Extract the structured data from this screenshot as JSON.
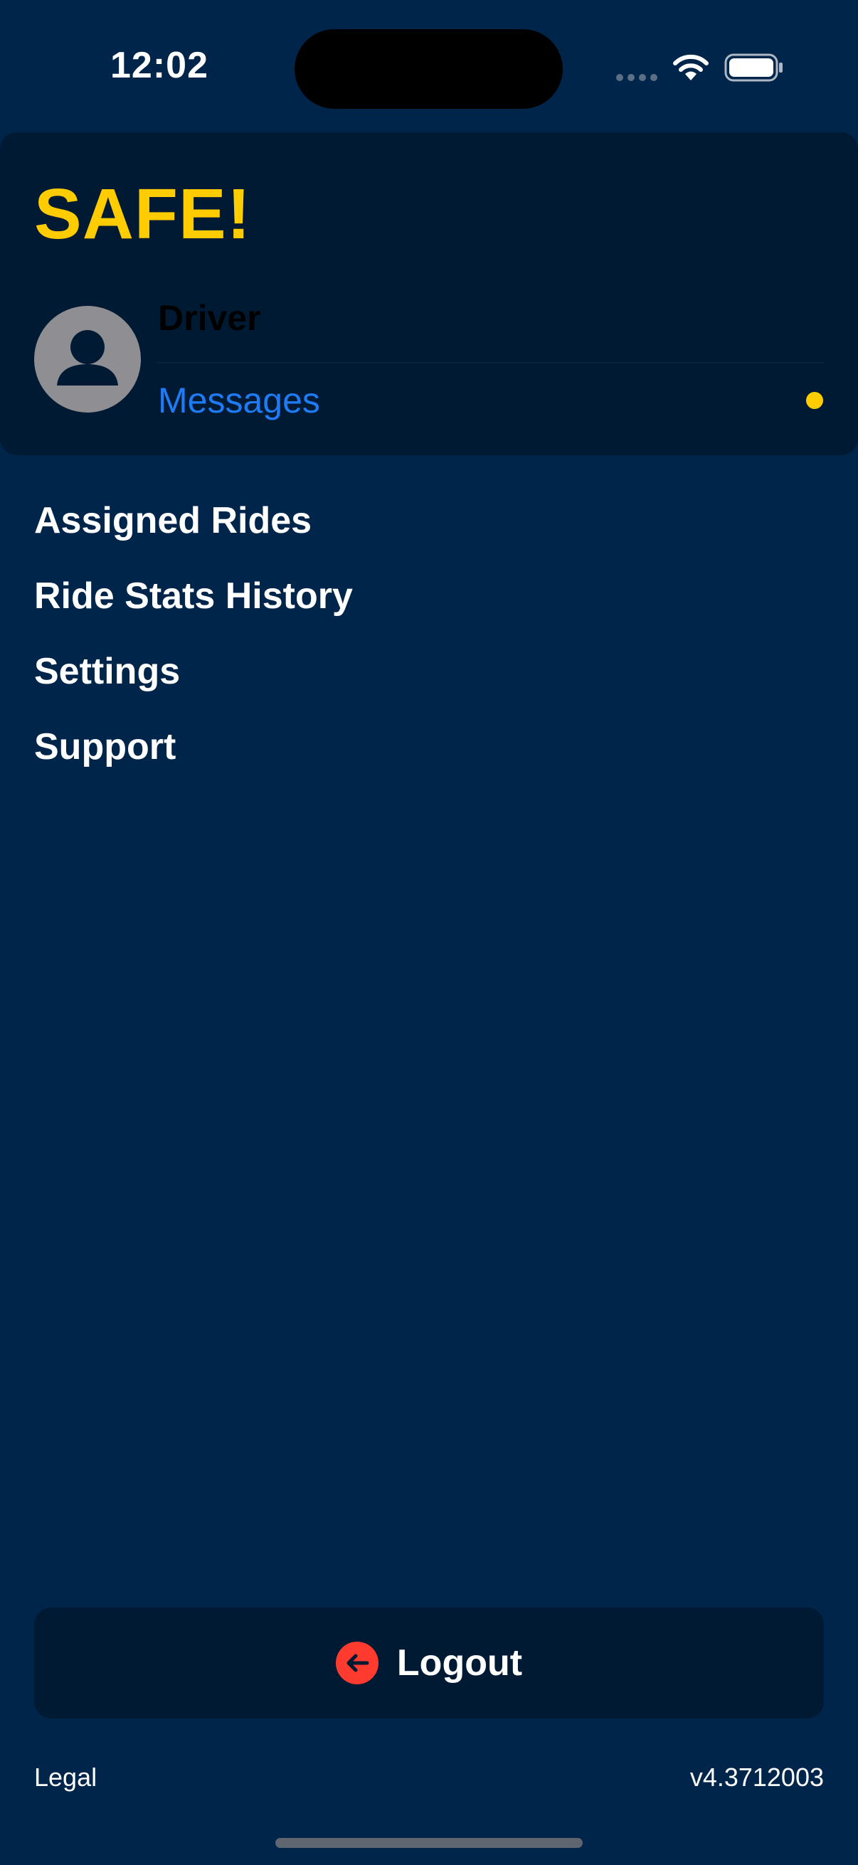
{
  "status_bar": {
    "time": "12:02"
  },
  "header": {
    "brand": "SAFE!",
    "user_name": "Driver",
    "messages_label": "Messages"
  },
  "menu": {
    "items": [
      {
        "label": "Assigned Rides"
      },
      {
        "label": "Ride Stats History"
      },
      {
        "label": "Settings"
      },
      {
        "label": "Support"
      }
    ]
  },
  "logout": {
    "label": "Logout"
  },
  "footer": {
    "legal": "Legal",
    "version": "v4.3712003"
  },
  "icons": {
    "avatar": "person-icon",
    "logout": "arrow-left-circle-icon",
    "wifi": "wifi-icon",
    "battery": "battery-icon",
    "signal": "cellular-signal-icon"
  },
  "colors": {
    "background": "#00254b",
    "card": "#011a33",
    "brand_accent": "#ffcc00",
    "link": "#1e7bf5",
    "logout_icon": "#ff3b30",
    "unread_dot": "#ffcc00"
  }
}
